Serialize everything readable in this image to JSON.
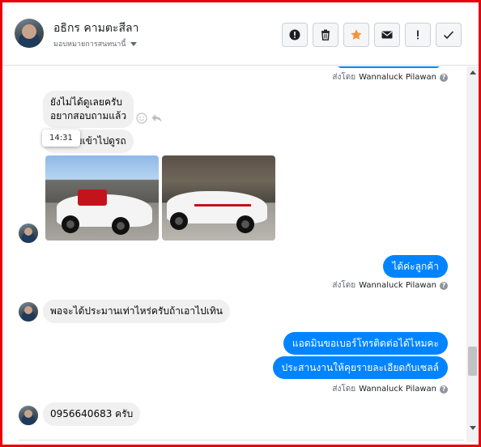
{
  "header": {
    "contact_name": "อธิกร คามตะสีลา",
    "assign_label": "มอบหมายการสนทนานี้"
  },
  "actions": [
    {
      "icon": "alert-circle-icon"
    },
    {
      "icon": "trash-icon"
    },
    {
      "icon": "star-icon",
      "color": "#f7923b"
    },
    {
      "icon": "envelope-icon"
    },
    {
      "icon": "exclamation-icon"
    },
    {
      "icon": "checkmark-icon"
    }
  ],
  "messages": {
    "sent_by_prefix": "ส่งโดย",
    "agent_name": "Wannaluck Pilawan",
    "incoming_1_line1": "ยังไม่ได้ดูเลยครับ",
    "incoming_1_line2": "อยากสอบถามแล้ว",
    "incoming_2": "เลยเข้าไปดูรถ",
    "tooltip_time": "14:31",
    "outgoing_1": "ได้ค่ะลูกค้า",
    "incoming_3": "พอจะได้ประมานเท่าไหร่ครับถ้าเอาไปเทิน",
    "outgoing_2": "แอดมินขอเบอร์โทรติดต่อได้ไหมคะ",
    "outgoing_3": "ประสานงานให้คุยรายละเอียดกับเซลล์",
    "incoming_4": "0956640683 ครับ"
  },
  "colors": {
    "accent": "#0084ff",
    "frame": "#e8000b",
    "incoming_bubble": "#f0f0f0"
  }
}
